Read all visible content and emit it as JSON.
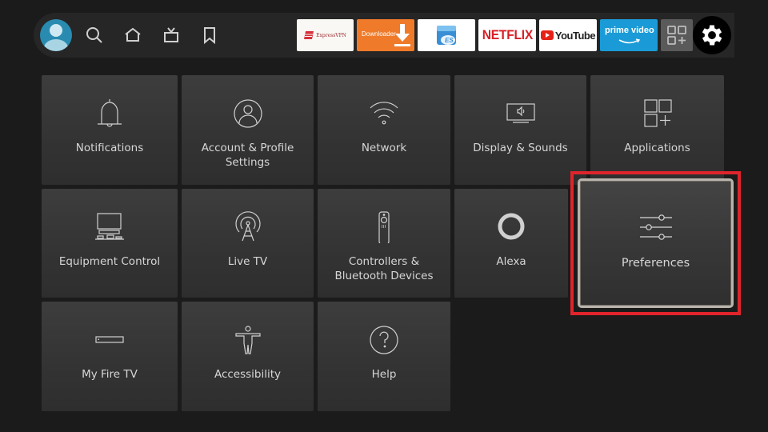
{
  "navbar": {
    "profile_icon": "profile-avatar",
    "icons": [
      {
        "name": "search-icon",
        "label": "Search"
      },
      {
        "name": "home-icon",
        "label": "Home"
      },
      {
        "name": "live-tv-icon",
        "label": "Live"
      },
      {
        "name": "bookmark-icon",
        "label": "Watchlist"
      }
    ],
    "apps": [
      {
        "id": "expressvpn",
        "label": "ExpressVPN"
      },
      {
        "id": "downloader",
        "label": "Downloader"
      },
      {
        "id": "es-file-explorer",
        "label": "ES"
      },
      {
        "id": "netflix",
        "label": "NETFLIX"
      },
      {
        "id": "youtube",
        "label": "YouTube"
      },
      {
        "id": "prime-video",
        "label": "prime video"
      },
      {
        "id": "all-apps",
        "label": "All Apps"
      }
    ],
    "settings_icon": "gear-icon"
  },
  "tiles": [
    {
      "id": "notifications",
      "label": "Notifications",
      "icon": "bell-icon"
    },
    {
      "id": "account-profile",
      "label": "Account & Profile Settings",
      "icon": "user-circle-icon"
    },
    {
      "id": "network",
      "label": "Network",
      "icon": "wifi-icon"
    },
    {
      "id": "display-sounds",
      "label": "Display & Sounds",
      "icon": "tv-speaker-icon"
    },
    {
      "id": "applications",
      "label": "Applications",
      "icon": "apps-grid-icon"
    },
    {
      "id": "equipment-control",
      "label": "Equipment Control",
      "icon": "equipment-icon"
    },
    {
      "id": "live-tv",
      "label": "Live TV",
      "icon": "antenna-icon"
    },
    {
      "id": "controllers-bluetooth",
      "label": "Controllers & Bluetooth Devices",
      "icon": "remote-icon"
    },
    {
      "id": "alexa",
      "label": "Alexa",
      "icon": "alexa-ring-icon"
    },
    {
      "id": "preferences",
      "label": "Preferences",
      "icon": "sliders-icon",
      "focused": true
    },
    {
      "id": "my-fire-tv",
      "label": "My Fire TV",
      "icon": "fire-tv-device-icon"
    },
    {
      "id": "accessibility",
      "label": "Accessibility",
      "icon": "accessibility-icon"
    },
    {
      "id": "help",
      "label": "Help",
      "icon": "help-circle-icon"
    }
  ],
  "colors": {
    "highlight": "#e0242c",
    "background": "#1b1b1b",
    "tile": "#363636",
    "downloader": "#ef7b2a",
    "prime": "#1a9bd7",
    "netflix": "#d81f26"
  }
}
